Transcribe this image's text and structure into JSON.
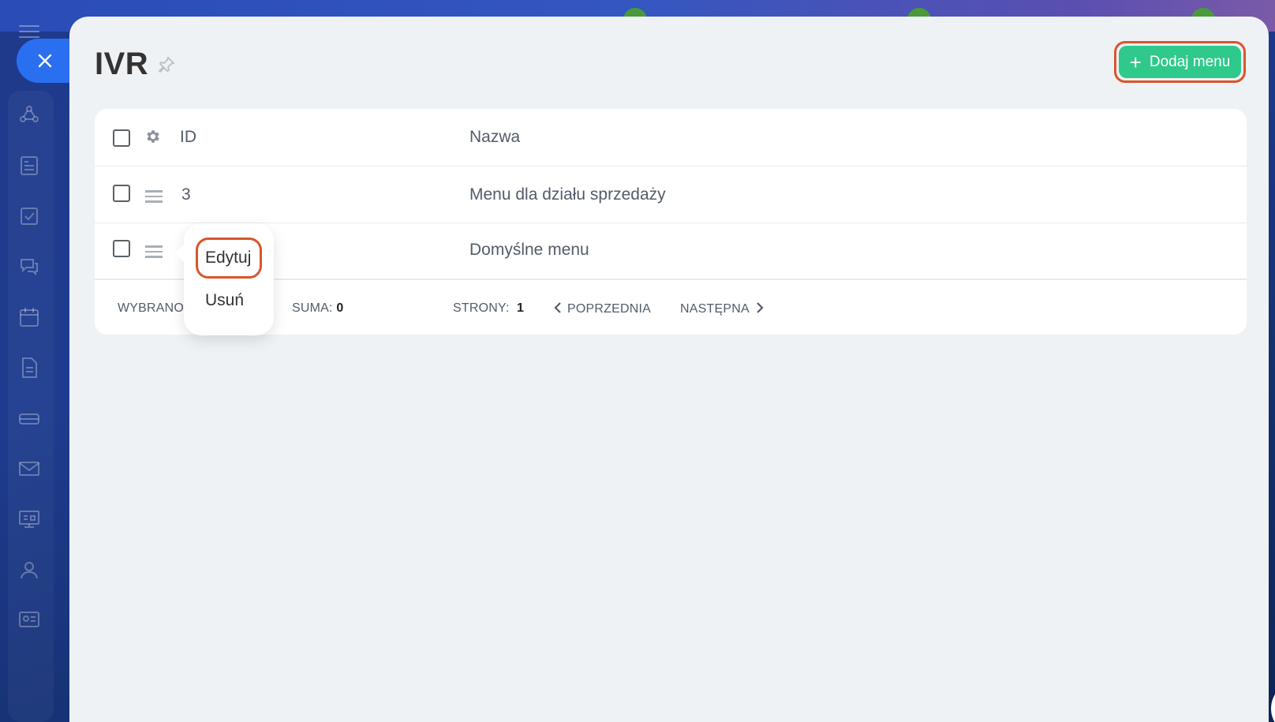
{
  "page": {
    "title": "IVR",
    "add_button_label": "Dodaj menu"
  },
  "grid": {
    "columns": [
      "ID",
      "Nazwa"
    ],
    "rows": [
      {
        "id": "3",
        "name": "Menu dla działu sprzedaży"
      },
      {
        "id": "",
        "name": "Domyślne menu"
      }
    ]
  },
  "footer": {
    "selected_label": "WYBRANO",
    "total_label": "SUMA:",
    "total_value": "0",
    "pages_label": "STRONY:",
    "pages_value": "1",
    "prev_label": "POPRZEDNIA",
    "next_label": "NASTĘPNA"
  },
  "context_menu": {
    "items": [
      "Edytuj",
      "Usuń"
    ]
  },
  "colors": {
    "accent_green": "#2fc98b",
    "highlight_orange": "#d9552b",
    "close_blue": "#2a6ff0"
  },
  "icons": {
    "rail": [
      "deals-icon",
      "documents-icon",
      "tasks-icon",
      "chat-icon",
      "calendar-icon",
      "file-icon",
      "storage-icon",
      "mail-icon",
      "board-icon",
      "contacts-icon",
      "vcard-icon"
    ]
  }
}
